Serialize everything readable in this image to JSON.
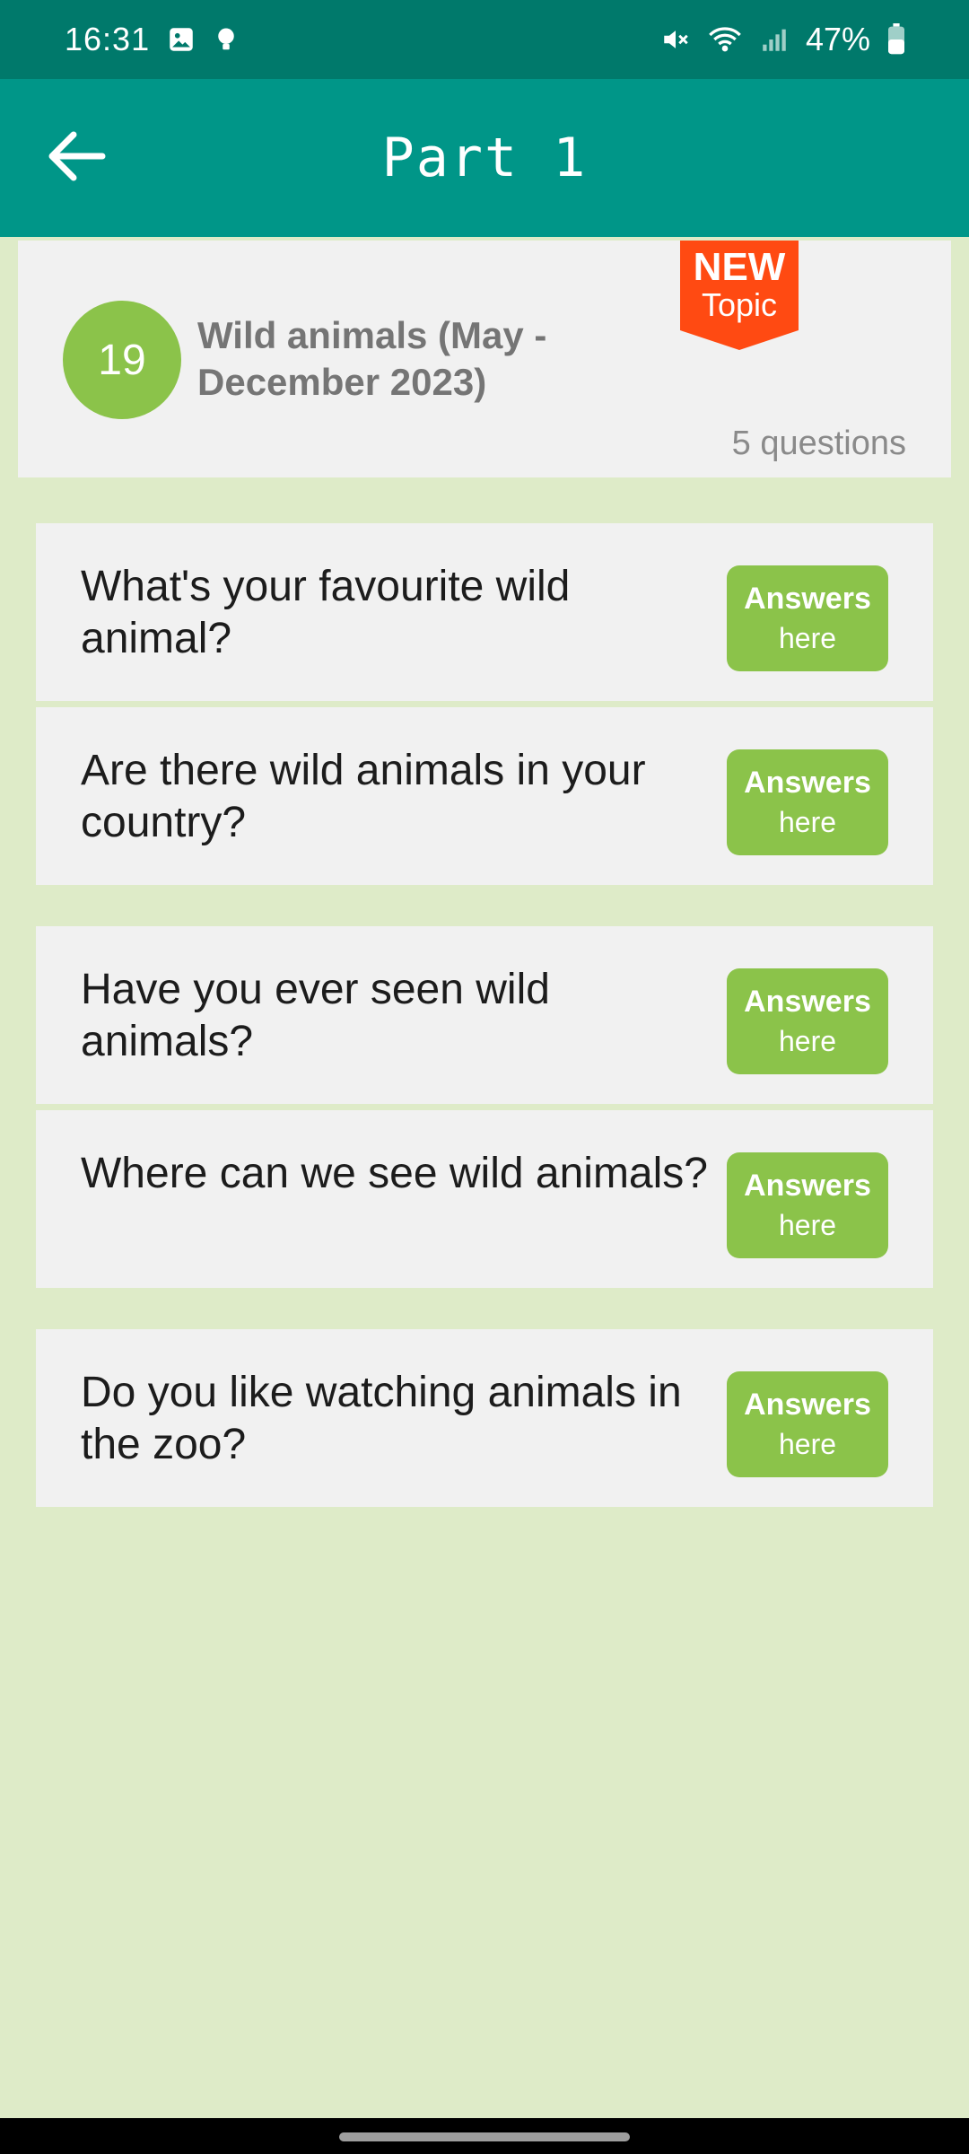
{
  "status_bar": {
    "time": "16:31",
    "battery": "47%",
    "icons": [
      "image-icon",
      "bulb-icon",
      "mute-icon",
      "wifi-icon",
      "signal-icon",
      "battery-icon"
    ]
  },
  "app_bar": {
    "title": "Part 1",
    "back_icon": "arrow-left-icon"
  },
  "topic": {
    "number": "19",
    "title": "Wild animals (May - December 2023)",
    "badge_line1": "NEW",
    "badge_line2": "Topic",
    "count": "5 questions"
  },
  "questions": [
    {
      "text": "What's your favourite wild animal?",
      "button_title": "Answers",
      "button_sub": "here"
    },
    {
      "text": "Are there wild animals in your country?",
      "button_title": "Answers",
      "button_sub": "here"
    },
    {
      "text": "Have you ever seen wild animals?",
      "button_title": "Answers",
      "button_sub": "here"
    },
    {
      "text": "Where can we see wild animals?",
      "button_title": "Answers",
      "button_sub": "here"
    },
    {
      "text": "Do you like watching animals in the zoo?",
      "button_title": "Answers",
      "button_sub": "here"
    }
  ],
  "colors": {
    "status_bar": "#00796b",
    "app_bar": "#009688",
    "background": "#deebc8",
    "accent_green": "#8bc34a",
    "badge_orange": "#ff4a12"
  }
}
